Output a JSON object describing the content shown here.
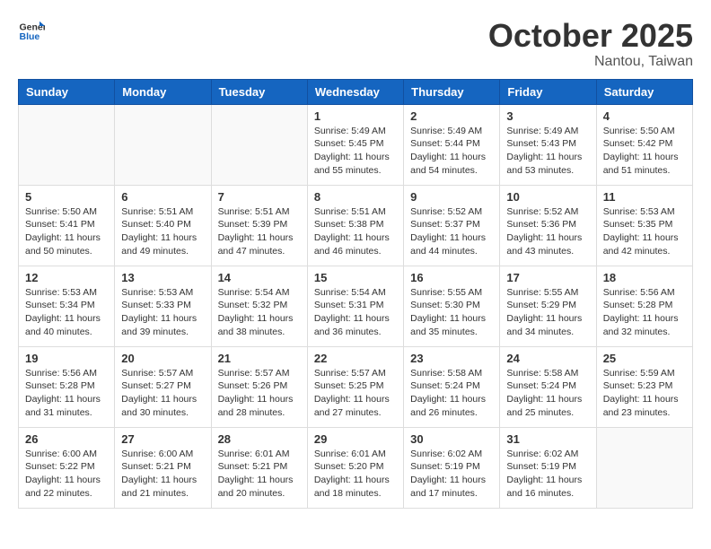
{
  "header": {
    "logo_line1": "General",
    "logo_line2": "Blue",
    "month_title": "October 2025",
    "location": "Nantou, Taiwan"
  },
  "weekdays": [
    "Sunday",
    "Monday",
    "Tuesday",
    "Wednesday",
    "Thursday",
    "Friday",
    "Saturday"
  ],
  "weeks": [
    [
      {
        "day": "",
        "info": ""
      },
      {
        "day": "",
        "info": ""
      },
      {
        "day": "",
        "info": ""
      },
      {
        "day": "1",
        "info": "Sunrise: 5:49 AM\nSunset: 5:45 PM\nDaylight: 11 hours\nand 55 minutes."
      },
      {
        "day": "2",
        "info": "Sunrise: 5:49 AM\nSunset: 5:44 PM\nDaylight: 11 hours\nand 54 minutes."
      },
      {
        "day": "3",
        "info": "Sunrise: 5:49 AM\nSunset: 5:43 PM\nDaylight: 11 hours\nand 53 minutes."
      },
      {
        "day": "4",
        "info": "Sunrise: 5:50 AM\nSunset: 5:42 PM\nDaylight: 11 hours\nand 51 minutes."
      }
    ],
    [
      {
        "day": "5",
        "info": "Sunrise: 5:50 AM\nSunset: 5:41 PM\nDaylight: 11 hours\nand 50 minutes."
      },
      {
        "day": "6",
        "info": "Sunrise: 5:51 AM\nSunset: 5:40 PM\nDaylight: 11 hours\nand 49 minutes."
      },
      {
        "day": "7",
        "info": "Sunrise: 5:51 AM\nSunset: 5:39 PM\nDaylight: 11 hours\nand 47 minutes."
      },
      {
        "day": "8",
        "info": "Sunrise: 5:51 AM\nSunset: 5:38 PM\nDaylight: 11 hours\nand 46 minutes."
      },
      {
        "day": "9",
        "info": "Sunrise: 5:52 AM\nSunset: 5:37 PM\nDaylight: 11 hours\nand 44 minutes."
      },
      {
        "day": "10",
        "info": "Sunrise: 5:52 AM\nSunset: 5:36 PM\nDaylight: 11 hours\nand 43 minutes."
      },
      {
        "day": "11",
        "info": "Sunrise: 5:53 AM\nSunset: 5:35 PM\nDaylight: 11 hours\nand 42 minutes."
      }
    ],
    [
      {
        "day": "12",
        "info": "Sunrise: 5:53 AM\nSunset: 5:34 PM\nDaylight: 11 hours\nand 40 minutes."
      },
      {
        "day": "13",
        "info": "Sunrise: 5:53 AM\nSunset: 5:33 PM\nDaylight: 11 hours\nand 39 minutes."
      },
      {
        "day": "14",
        "info": "Sunrise: 5:54 AM\nSunset: 5:32 PM\nDaylight: 11 hours\nand 38 minutes."
      },
      {
        "day": "15",
        "info": "Sunrise: 5:54 AM\nSunset: 5:31 PM\nDaylight: 11 hours\nand 36 minutes."
      },
      {
        "day": "16",
        "info": "Sunrise: 5:55 AM\nSunset: 5:30 PM\nDaylight: 11 hours\nand 35 minutes."
      },
      {
        "day": "17",
        "info": "Sunrise: 5:55 AM\nSunset: 5:29 PM\nDaylight: 11 hours\nand 34 minutes."
      },
      {
        "day": "18",
        "info": "Sunrise: 5:56 AM\nSunset: 5:28 PM\nDaylight: 11 hours\nand 32 minutes."
      }
    ],
    [
      {
        "day": "19",
        "info": "Sunrise: 5:56 AM\nSunset: 5:28 PM\nDaylight: 11 hours\nand 31 minutes."
      },
      {
        "day": "20",
        "info": "Sunrise: 5:57 AM\nSunset: 5:27 PM\nDaylight: 11 hours\nand 30 minutes."
      },
      {
        "day": "21",
        "info": "Sunrise: 5:57 AM\nSunset: 5:26 PM\nDaylight: 11 hours\nand 28 minutes."
      },
      {
        "day": "22",
        "info": "Sunrise: 5:57 AM\nSunset: 5:25 PM\nDaylight: 11 hours\nand 27 minutes."
      },
      {
        "day": "23",
        "info": "Sunrise: 5:58 AM\nSunset: 5:24 PM\nDaylight: 11 hours\nand 26 minutes."
      },
      {
        "day": "24",
        "info": "Sunrise: 5:58 AM\nSunset: 5:24 PM\nDaylight: 11 hours\nand 25 minutes."
      },
      {
        "day": "25",
        "info": "Sunrise: 5:59 AM\nSunset: 5:23 PM\nDaylight: 11 hours\nand 23 minutes."
      }
    ],
    [
      {
        "day": "26",
        "info": "Sunrise: 6:00 AM\nSunset: 5:22 PM\nDaylight: 11 hours\nand 22 minutes."
      },
      {
        "day": "27",
        "info": "Sunrise: 6:00 AM\nSunset: 5:21 PM\nDaylight: 11 hours\nand 21 minutes."
      },
      {
        "day": "28",
        "info": "Sunrise: 6:01 AM\nSunset: 5:21 PM\nDaylight: 11 hours\nand 20 minutes."
      },
      {
        "day": "29",
        "info": "Sunrise: 6:01 AM\nSunset: 5:20 PM\nDaylight: 11 hours\nand 18 minutes."
      },
      {
        "day": "30",
        "info": "Sunrise: 6:02 AM\nSunset: 5:19 PM\nDaylight: 11 hours\nand 17 minutes."
      },
      {
        "day": "31",
        "info": "Sunrise: 6:02 AM\nSunset: 5:19 PM\nDaylight: 11 hours\nand 16 minutes."
      },
      {
        "day": "",
        "info": ""
      }
    ]
  ]
}
